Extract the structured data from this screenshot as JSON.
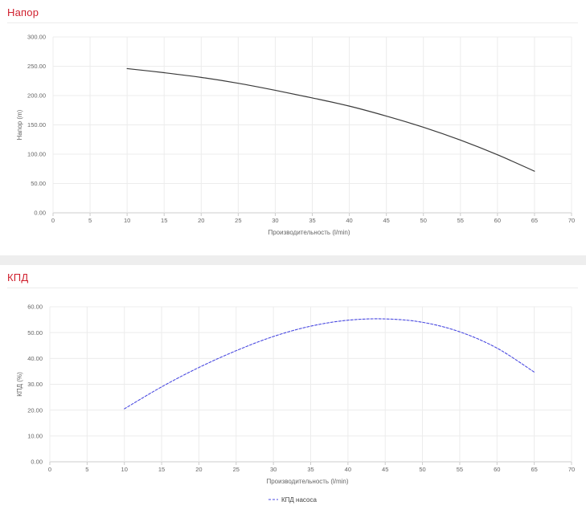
{
  "panels": {
    "head": {
      "title": "Напор"
    },
    "efficiency": {
      "title": "КПД"
    }
  },
  "chart_data": [
    {
      "type": "line",
      "title": "Напор",
      "xlabel": "Производительность (l/min)",
      "ylabel": "Напор (m)",
      "xlim": [
        0,
        70
      ],
      "ylim": [
        0,
        300
      ],
      "xticks": [
        0,
        5,
        10,
        15,
        20,
        25,
        30,
        35,
        40,
        45,
        50,
        55,
        60,
        65,
        70
      ],
      "yticks": [
        "0.00",
        "50.00",
        "100.00",
        "150.00",
        "200.00",
        "250.00",
        "300.00"
      ],
      "grid": true,
      "legend": "none",
      "color": "#3a3a3a",
      "series": [
        {
          "x": [
            10,
            15,
            20,
            25,
            30,
            35,
            40,
            45,
            50,
            55,
            60,
            65
          ],
          "y": [
            246,
            239,
            231,
            221,
            209,
            196,
            182,
            165,
            146,
            124,
            99,
            71
          ]
        }
      ]
    },
    {
      "type": "line",
      "title": "КПД",
      "xlabel": "Производительность (l/min)",
      "ylabel": "КПД (%)",
      "xlim": [
        0,
        70
      ],
      "ylim": [
        0,
        60
      ],
      "xticks": [
        0,
        5,
        10,
        15,
        20,
        25,
        30,
        35,
        40,
        45,
        50,
        55,
        60,
        65,
        70
      ],
      "yticks": [
        "0.00",
        "10.00",
        "20.00",
        "30.00",
        "40.00",
        "50.00",
        "60.00"
      ],
      "grid": true,
      "legend": "bottom-center",
      "color": "#4a4ae0",
      "dashed": true,
      "series": [
        {
          "name": "КПД насоса",
          "x": [
            10,
            15,
            20,
            25,
            30,
            35,
            40,
            45,
            50,
            55,
            60,
            65
          ],
          "y": [
            20.5,
            29,
            36.5,
            43,
            48.5,
            52.5,
            54.8,
            55.3,
            54,
            50.3,
            44,
            34.7
          ]
        }
      ]
    }
  ]
}
